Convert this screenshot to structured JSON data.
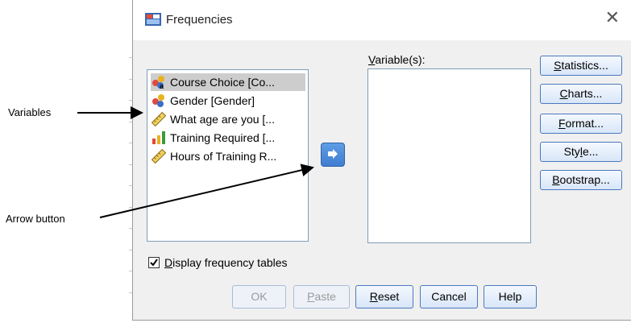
{
  "annotations": {
    "variables_label": "Variables",
    "arrow_button_label": "Arrow button"
  },
  "dialog": {
    "title": "Frequencies",
    "close_icon": "close-icon",
    "variables": [
      {
        "name": "Course Choice [Co...",
        "icon": "nominal-icon",
        "selected": true
      },
      {
        "name": "Gender [Gender]",
        "icon": "nominal-icon",
        "selected": false
      },
      {
        "name": "What age are you [...",
        "icon": "scale-icon",
        "selected": false
      },
      {
        "name": "Training Required [...",
        "icon": "ordinal-icon",
        "selected": false
      },
      {
        "name": "Hours of Training R...",
        "icon": "scale-icon",
        "selected": false
      }
    ],
    "target_label_mnemonic": "V",
    "target_label_rest": "ariable(s):",
    "side_buttons": [
      {
        "mnemonic": "S",
        "rest": "tatistics..."
      },
      {
        "mnemonic": "C",
        "rest": "harts..."
      },
      {
        "mnemonic": "F",
        "rest": "ormat..."
      },
      {
        "pre": "Sty",
        "mnemonic": "l",
        "rest": "e..."
      },
      {
        "mnemonic": "B",
        "rest": "ootstrap..."
      }
    ],
    "checkbox": {
      "mnemonic": "D",
      "rest": "isplay frequency tables",
      "checked": true
    },
    "bottom_buttons": {
      "ok": "OK",
      "paste_mnemonic": "P",
      "paste_rest": "aste",
      "reset_mnemonic": "R",
      "reset_rest": "eset",
      "cancel": "Cancel",
      "help": "Help"
    }
  }
}
